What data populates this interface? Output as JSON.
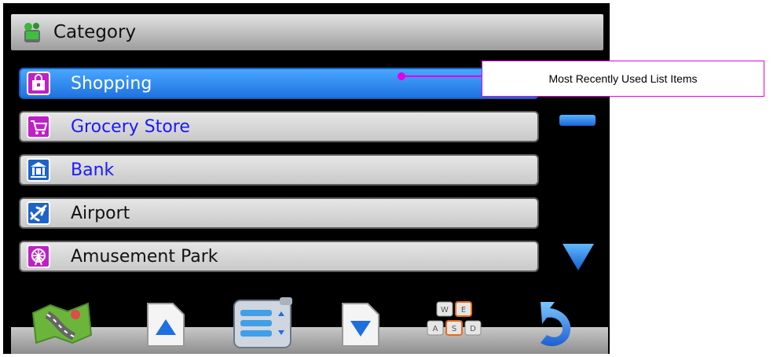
{
  "header": {
    "title": "Category",
    "icon": "category-icon"
  },
  "list": {
    "items": [
      {
        "label": "Shopping",
        "icon": "shopping-bag-icon",
        "selected": true
      },
      {
        "label": "Grocery Store",
        "icon": "shopping-cart-icon",
        "selected": false
      },
      {
        "label": "Bank",
        "icon": "bank-icon",
        "selected": false
      },
      {
        "label": "Airport",
        "icon": "airplane-icon",
        "selected": false
      },
      {
        "label": "Amusement Park",
        "icon": "ferris-wheel-icon",
        "selected": false
      }
    ]
  },
  "toolbar": {
    "buttons": [
      {
        "name": "map-button",
        "icon": "map-icon"
      },
      {
        "name": "page-up-button",
        "icon": "page-up-icon"
      },
      {
        "name": "list-view-button",
        "icon": "list-icon"
      },
      {
        "name": "page-down-button",
        "icon": "page-down-icon"
      },
      {
        "name": "keyboard-button",
        "icon": "keyboard-icon",
        "keys": [
          "W",
          "E",
          "A",
          "S",
          "D"
        ]
      },
      {
        "name": "back-button",
        "icon": "back-arrow-icon"
      }
    ]
  },
  "callout": {
    "text": "Most Recently Used List Items"
  },
  "colors": {
    "selected_row": "#1f73e0",
    "accent_magenta": "#e300e3",
    "text_blue": "#1a1aff"
  }
}
